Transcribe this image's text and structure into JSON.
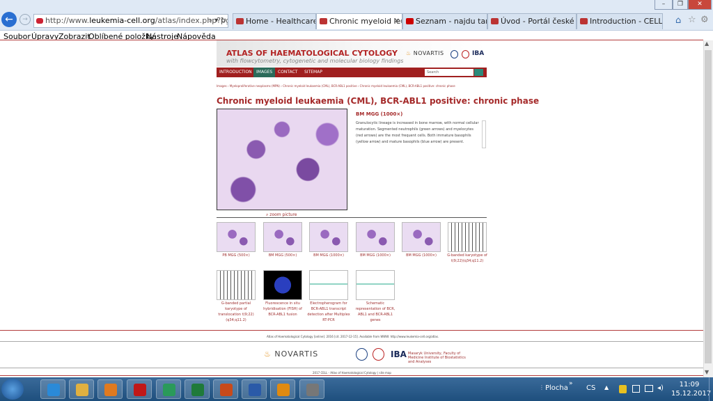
{
  "browser": {
    "window_controls": [
      "–",
      "❐",
      "✕"
    ],
    "address_prefix": "http://www.",
    "address_host": "leukemia-cell.org",
    "address_rest": "/atlas/index.php?pg=in",
    "tabs": [
      {
        "label": "Home - Healthcare Alli..."
      },
      {
        "label": "Chronic myeloid leu...",
        "close": "✕"
      },
      {
        "label": "Seznam - najdu tam, c..."
      },
      {
        "label": "Úvod - Portál české leu..."
      },
      {
        "label": "Introduction - CELL - A..."
      }
    ]
  },
  "menubar": {
    "items": [
      "Soubor",
      "Úpravy",
      "Zobrazit",
      "Oblíbené položky",
      "Nástroje",
      "Nápověda"
    ]
  },
  "site": {
    "title": "ATLAS OF HAEMATOLOGICAL CYTOLOGY",
    "subtitle": "with flowcytometry, cytogenetic and molecular biology findings",
    "novartis": "NOVARTIS",
    "iba": "IBA",
    "nav": [
      "INTRODUCTION",
      "IMAGES",
      "CONTACT",
      "SITEMAP"
    ],
    "search_placeholder": "Search",
    "breadcrumbs": "Images  ›  Myeloproliferative neoplasms (MPN)  ›  Chronic myeloid leukaemia (CML), BCR-ABL1 positive  ›  Chronic myeloid leukaemia (CML), BCR-ABL1 positive: chronic phase"
  },
  "main": {
    "page_title": "Chronic myeloid leukaemia (CML), BCR-ABL1 positive: chronic phase",
    "image_title": "BM MGG (1000×)",
    "description": "Granulocytic lineage is increased in bone marrow, with normal cellular maturation. Segmented neutrophils (green arrows) and myelocytes (red arrows) are the most frequent cells. Both immature basophils (yellow arrow) and mature basophils (blue arrow) are present.",
    "zoom_label": "zoom picture"
  },
  "thumbnails": [
    {
      "caption": "PB MGG (500×)",
      "kind": "cells"
    },
    {
      "caption": "BM MGG (500×)",
      "kind": "cells"
    },
    {
      "caption": "BM MGG (1000×)",
      "kind": "cells"
    },
    {
      "caption": "BM MGG (1000×)",
      "kind": "cells"
    },
    {
      "caption": "BM MGG (1000×)",
      "kind": "cells"
    },
    {
      "caption": "G-banded karyotype of t(9;22)(q34;q11.2)",
      "kind": "kary"
    },
    {
      "caption": "G-banded partial karyotype of translocation t(9;22)(q34;q11.2)",
      "kind": "kary"
    },
    {
      "caption": "Fluorescence in situ hybridisation (FISH) of BCR-ABL1 fusion",
      "kind": "fish"
    },
    {
      "caption": "Electropherogram for BCR-ABL1 transcript detection after Multiplex RT-PCR",
      "kind": "chart"
    },
    {
      "caption": "Schematic representation of BCR, ABL1 and BCR-ABL1 genes",
      "kind": "chart"
    }
  ],
  "footer": {
    "citation": "Atlas of Haematological Cytology [online]. 2016 [cit. 2017-12-15]. Available from WWW: http://www.leukemia-cell.org/atlas.",
    "novartis": "NOVARTIS",
    "iba": "IBA",
    "university": "Masaryk University, Faculty of Medicine Institute of Biostatistics and Analyses",
    "copyright": "2017 CELL - Atlas of Haematological Cytology | site map"
  },
  "taskbar": {
    "desktop_label": "Plocha",
    "lang": "CS",
    "time": "11:09",
    "date": "15.12.2017",
    "apps": [
      {
        "name": "ie",
        "color": "#2a8ad8"
      },
      {
        "name": "explorer",
        "color": "#e0b040"
      },
      {
        "name": "media",
        "color": "#e07a20"
      },
      {
        "name": "acrobat",
        "color": "#c01818"
      },
      {
        "name": "paint",
        "color": "#2a9a5a"
      },
      {
        "name": "excel",
        "color": "#1f7a3a"
      },
      {
        "name": "powerpoint",
        "color": "#c84a1a"
      },
      {
        "name": "word",
        "color": "#2a5aa8"
      },
      {
        "name": "outlook",
        "color": "#e08a10"
      },
      {
        "name": "speakers",
        "color": "#777"
      }
    ]
  }
}
